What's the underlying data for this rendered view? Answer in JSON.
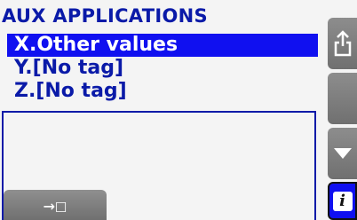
{
  "header": {
    "title": "AUX APPLICATIONS"
  },
  "list": {
    "items": [
      {
        "label": "X.Other values",
        "selected": true
      },
      {
        "label": "Y.[No tag]",
        "selected": false
      },
      {
        "label": "Z.[No tag]",
        "selected": false
      }
    ]
  },
  "buttons": {
    "enter": {
      "glyph": "→☐",
      "icon": "enter-icon"
    },
    "export": {
      "icon": "export-icon"
    },
    "blank": {
      "icon": "none"
    },
    "down": {
      "icon": "chevron-down-icon"
    },
    "info": {
      "glyph": "i",
      "icon": "info-icon"
    }
  },
  "colors": {
    "accent": "#0a1aa8",
    "selection": "#1010f0",
    "button": "#7d7d7d",
    "background": "#f4f4f4"
  }
}
